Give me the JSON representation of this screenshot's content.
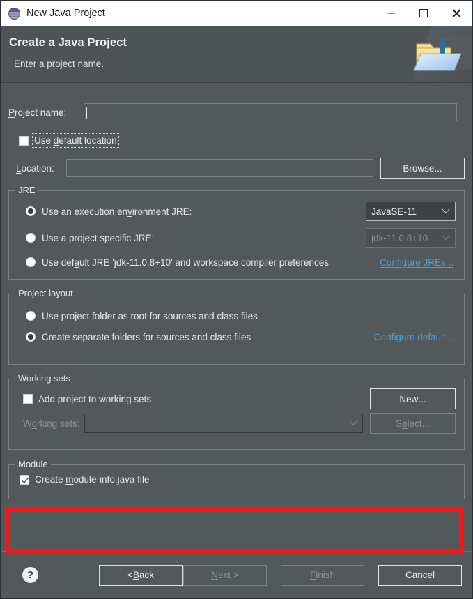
{
  "window": {
    "title": "New Java Project",
    "app_icon": "eclipse-icon",
    "controls": {
      "minimize": "minimize-icon",
      "maximize": "maximize-icon",
      "close": "close-icon"
    }
  },
  "header": {
    "title": "Create a Java Project",
    "subtitle": "Enter a project name.",
    "art_icon": "java-project-folder-icon"
  },
  "form": {
    "project_name": {
      "label": "Project name:",
      "value": "",
      "placeholder": ""
    },
    "use_default_location": {
      "label": "Use default location",
      "checked": false,
      "focused": true
    },
    "location": {
      "label": "Location:",
      "value": "",
      "placeholder": ""
    },
    "browse_button": "Browse..."
  },
  "jre_group": {
    "title": "JRE",
    "options": [
      {
        "label": "Use an execution environment JRE:",
        "selected": true
      },
      {
        "label": "Use a project specific JRE:",
        "selected": false
      },
      {
        "label": "Use default JRE 'jdk-11.0.8+10' and workspace compiler preferences",
        "selected": false
      }
    ],
    "execution_env_combo": {
      "value": "JavaSE-11",
      "enabled": true
    },
    "project_jre_combo": {
      "value": "jdk-11.0.8+10",
      "enabled": false
    },
    "configure_link": "Configure JREs..."
  },
  "project_layout_group": {
    "title": "Project layout",
    "options": [
      {
        "label": "Use project folder as root for sources and class files",
        "selected": false
      },
      {
        "label": "Create separate folders for sources and class files",
        "selected": true
      }
    ],
    "configure_link": "Configure default..."
  },
  "working_sets_group": {
    "title": "Working sets",
    "add_to_working_sets": {
      "label": "Add project to working sets",
      "checked": false
    },
    "new_button": "New...",
    "working_sets_label": "Working sets:",
    "working_sets_combo": {
      "value": "",
      "enabled": false
    },
    "select_button": "Select...",
    "select_button_enabled": false
  },
  "module_group": {
    "title": "Module",
    "create_module_info": {
      "label": "Create module-info.java file",
      "checked": true
    },
    "highlight_color": "#fb1414"
  },
  "footer": {
    "help_icon": "help-icon",
    "help_glyph": "?",
    "buttons": [
      {
        "label": "< Back",
        "enabled": true
      },
      {
        "label": "Next >",
        "enabled": false
      },
      {
        "label": "Finish",
        "enabled": false
      },
      {
        "label": "Cancel",
        "enabled": true
      }
    ]
  },
  "colors": {
    "dialog_bg": "#53585b",
    "header_bg": "#4e5356",
    "titlebar_bg": "#ffffff",
    "link": "#4a9fd8",
    "highlight": "#fb1414",
    "text": "#e8e8e8",
    "disabled_text": "#8d9295"
  }
}
